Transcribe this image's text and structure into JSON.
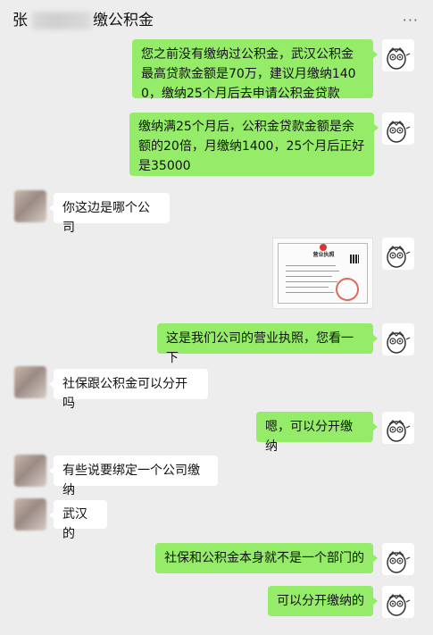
{
  "header": {
    "title_prefix": "张",
    "title_suffix": "缴公积金",
    "more_icon": "more-icon"
  },
  "messages": [
    {
      "from": "me",
      "text": "您之前没有缴纳过公积金，武汉公积金最高贷款金额是70万，建议月缴纳1400，缴纳25个月后去申请公积金贷款"
    },
    {
      "from": "me",
      "text": "缴纳满25个月后，公积金贷款金额是余额的20倍，月缴纳1400，25个月后正好是35000"
    },
    {
      "from": "other",
      "text": "你这边是哪个公司"
    },
    {
      "from": "me",
      "type": "image",
      "image": {
        "heading": "营业执照"
      }
    },
    {
      "from": "me",
      "text": "这是我们公司的营业执照，您看一下"
    },
    {
      "from": "other",
      "text": "社保跟公积金可以分开吗"
    },
    {
      "from": "me",
      "text": "嗯，可以分开缴纳"
    },
    {
      "from": "other",
      "text": "有些说要绑定一个公司缴纳"
    },
    {
      "from": "other",
      "text": "武汉的"
    },
    {
      "from": "me",
      "text": "社保和公积金本身就不是一个部门的"
    },
    {
      "from": "me",
      "text": "可以分开缴纳的"
    }
  ],
  "colors": {
    "background": "#ededed",
    "my_bubble": "#95ec69",
    "other_bubble": "#ffffff"
  }
}
